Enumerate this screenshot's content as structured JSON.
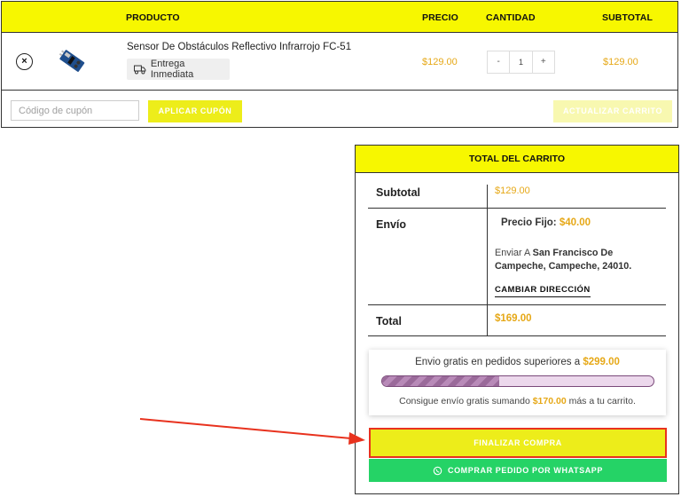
{
  "cart": {
    "headers": {
      "product": "PRODUCTO",
      "price": "PRECIO",
      "quantity": "CANTIDAD",
      "subtotal": "SUBTOTAL"
    },
    "item": {
      "remove_symbol": "×",
      "name": "Sensor De Obstáculos Reflectivo Infrarrojo FC-51",
      "delivery_label": "Entrega Inmediata",
      "delivery_icon": "truck-icon",
      "price": "$129.00",
      "quantity": "1",
      "minus": "-",
      "plus": "+",
      "subtotal": "$129.00"
    },
    "coupon": {
      "placeholder": "Código de cupón",
      "apply_label": "APLICAR CUPÓN"
    },
    "update_label": "ACTUALIZAR CARRITO"
  },
  "totals": {
    "title": "TOTAL DEL CARRITO",
    "subtotal_label": "Subtotal",
    "subtotal_value": "$129.00",
    "shipping_label": "Envío",
    "shipping_method": "Precio Fijo:",
    "shipping_amount": "$40.00",
    "shipping_dest_prefix": "Enviar A",
    "shipping_dest": "San Francisco De Campeche, Campeche, 24010.",
    "change_address": "CAMBIAR DIRECCIÓN",
    "total_label": "Total",
    "total_value": "$169.00",
    "free_shipping": {
      "title": "Envio gratis en pedidos superiores a",
      "threshold": "$299.00",
      "progress_fraction": 0.43,
      "note_prefix": "Consigue envío gratis sumando",
      "remaining": "$170.00",
      "note_suffix": "más a tu carrito."
    },
    "checkout_label": "FINALIZAR COMPRA",
    "whatsapp_label": "COMPRAR PEDIDO POR WHATSAPP",
    "whatsapp_icon": "whatsapp-icon"
  },
  "colors": {
    "accent_yellow": "#f7f700",
    "price_orange": "#e6a817",
    "whatsapp_green": "#25d366",
    "annotation_red": "#e8321e"
  }
}
